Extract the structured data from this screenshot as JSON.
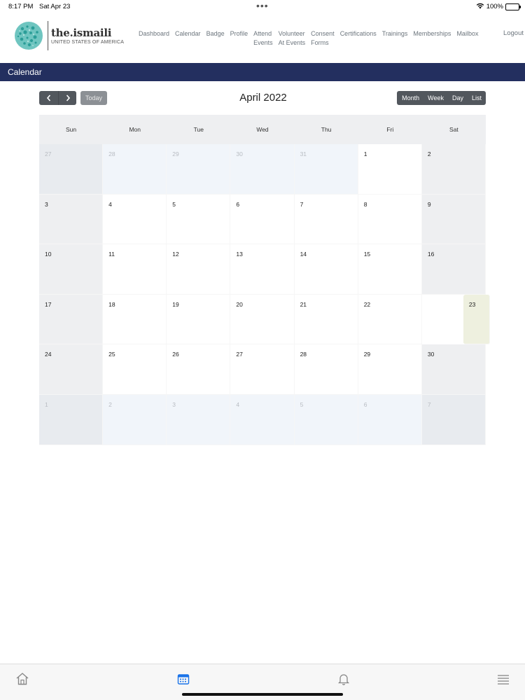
{
  "status": {
    "time": "8:17 PM",
    "date": "Sat Apr 23",
    "dots": "•••",
    "battery": "100%"
  },
  "brand": {
    "name": "the.ismaili",
    "subtitle": "UNITED STATES OF AMERICA"
  },
  "nav": {
    "items": [
      {
        "label": "Dashboard"
      },
      {
        "label": "Calendar"
      },
      {
        "label": "Badge"
      },
      {
        "label": "Profile"
      },
      {
        "label": "Attend\nEvents"
      },
      {
        "label": "Volunteer\nAt Events"
      },
      {
        "label": "Consent\nForms"
      },
      {
        "label": "Certifications"
      },
      {
        "label": "Trainings"
      },
      {
        "label": "Memberships"
      },
      {
        "label": "Mailbox"
      }
    ],
    "logout": "Logout"
  },
  "page": {
    "title": "Calendar"
  },
  "toolbar": {
    "prev_icon": "chevron-left-icon",
    "next_icon": "chevron-right-icon",
    "today_label": "Today",
    "current_month": "April 2022",
    "views": [
      "Month",
      "Week",
      "Day",
      "List"
    ]
  },
  "calendar": {
    "weekdays": [
      "Sun",
      "Mon",
      "Tue",
      "Wed",
      "Thu",
      "Fri",
      "Sat"
    ],
    "weeks": [
      [
        {
          "d": "27",
          "other": true
        },
        {
          "d": "28",
          "other": true
        },
        {
          "d": "29",
          "other": true
        },
        {
          "d": "30",
          "other": true
        },
        {
          "d": "31",
          "other": true
        },
        {
          "d": "1"
        },
        {
          "d": "2"
        }
      ],
      [
        {
          "d": "3"
        },
        {
          "d": "4"
        },
        {
          "d": "5"
        },
        {
          "d": "6"
        },
        {
          "d": "7"
        },
        {
          "d": "8"
        },
        {
          "d": "9"
        }
      ],
      [
        {
          "d": "10"
        },
        {
          "d": "11"
        },
        {
          "d": "12"
        },
        {
          "d": "13"
        },
        {
          "d": "14"
        },
        {
          "d": "15"
        },
        {
          "d": "16"
        }
      ],
      [
        {
          "d": "17"
        },
        {
          "d": "18"
        },
        {
          "d": "19"
        },
        {
          "d": "20"
        },
        {
          "d": "21"
        },
        {
          "d": "22"
        },
        {
          "d": "23",
          "today": true
        }
      ],
      [
        {
          "d": "24"
        },
        {
          "d": "25"
        },
        {
          "d": "26"
        },
        {
          "d": "27"
        },
        {
          "d": "28"
        },
        {
          "d": "29"
        },
        {
          "d": "30"
        }
      ],
      [
        {
          "d": "1",
          "other": true
        },
        {
          "d": "2",
          "other": true
        },
        {
          "d": "3",
          "other": true
        },
        {
          "d": "4",
          "other": true
        },
        {
          "d": "5",
          "other": true
        },
        {
          "d": "6",
          "other": true
        },
        {
          "d": "7",
          "other": true
        }
      ]
    ]
  },
  "tabbar": {
    "tabs": [
      {
        "name": "home-icon",
        "active": false
      },
      {
        "name": "calendar-icon",
        "active": true
      },
      {
        "name": "bell-icon",
        "active": false
      },
      {
        "name": "menu-icon",
        "active": false
      }
    ]
  },
  "colors": {
    "header_bar": "#232f5f",
    "button": "#52575d",
    "today_bg": "#eef0df",
    "active_tab": "#1a73e8"
  }
}
